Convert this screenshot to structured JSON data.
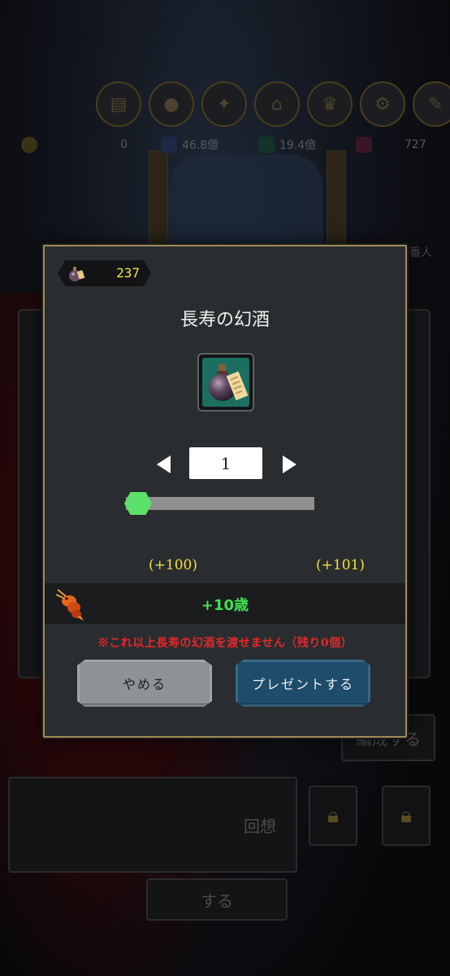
{
  "background": {
    "top_icons": [
      "book-icon",
      "orb-icon",
      "bird-icon",
      "home-icon",
      "trophy-icon",
      "gear-icon",
      "wrench-icon"
    ],
    "resources": [
      {
        "icon": "coin-icon",
        "value": "0",
        "color": "#b48a2a"
      },
      {
        "icon": "blue-gem-icon",
        "value": "46.8億",
        "color": "#2d5fa8"
      },
      {
        "icon": "green-gem-icon",
        "value": "19.4億",
        "color": "#1f9a6a"
      },
      {
        "icon": "diamond-icon",
        "value": "727",
        "color": "#c0306a"
      }
    ],
    "side_label": "番人",
    "edit_button": "編成する",
    "recall_button": "回想",
    "do_button": "する"
  },
  "dialog": {
    "owned_count": "237",
    "title": "長寿の幻酒",
    "item_icon": "elixir-bottle-icon",
    "quantity": "1",
    "slider_fraction": 0.0,
    "stat_before": "(+100)",
    "stat_after": "(+101)",
    "effect_icon": "shrimp-icon",
    "effect_text": "+10歳",
    "warning": "※これ以上長寿の幻酒を渡せません（残り0個）",
    "cancel_label": "やめる",
    "present_label": "プレゼントする"
  },
  "colors": {
    "accent_gold": "#a08c5a",
    "count_yellow": "#f4e63b",
    "effect_green": "#3ee04f",
    "warning_red": "#e8262b",
    "present_blue": "#1e4c6b",
    "cancel_gray": "#8e9196"
  }
}
